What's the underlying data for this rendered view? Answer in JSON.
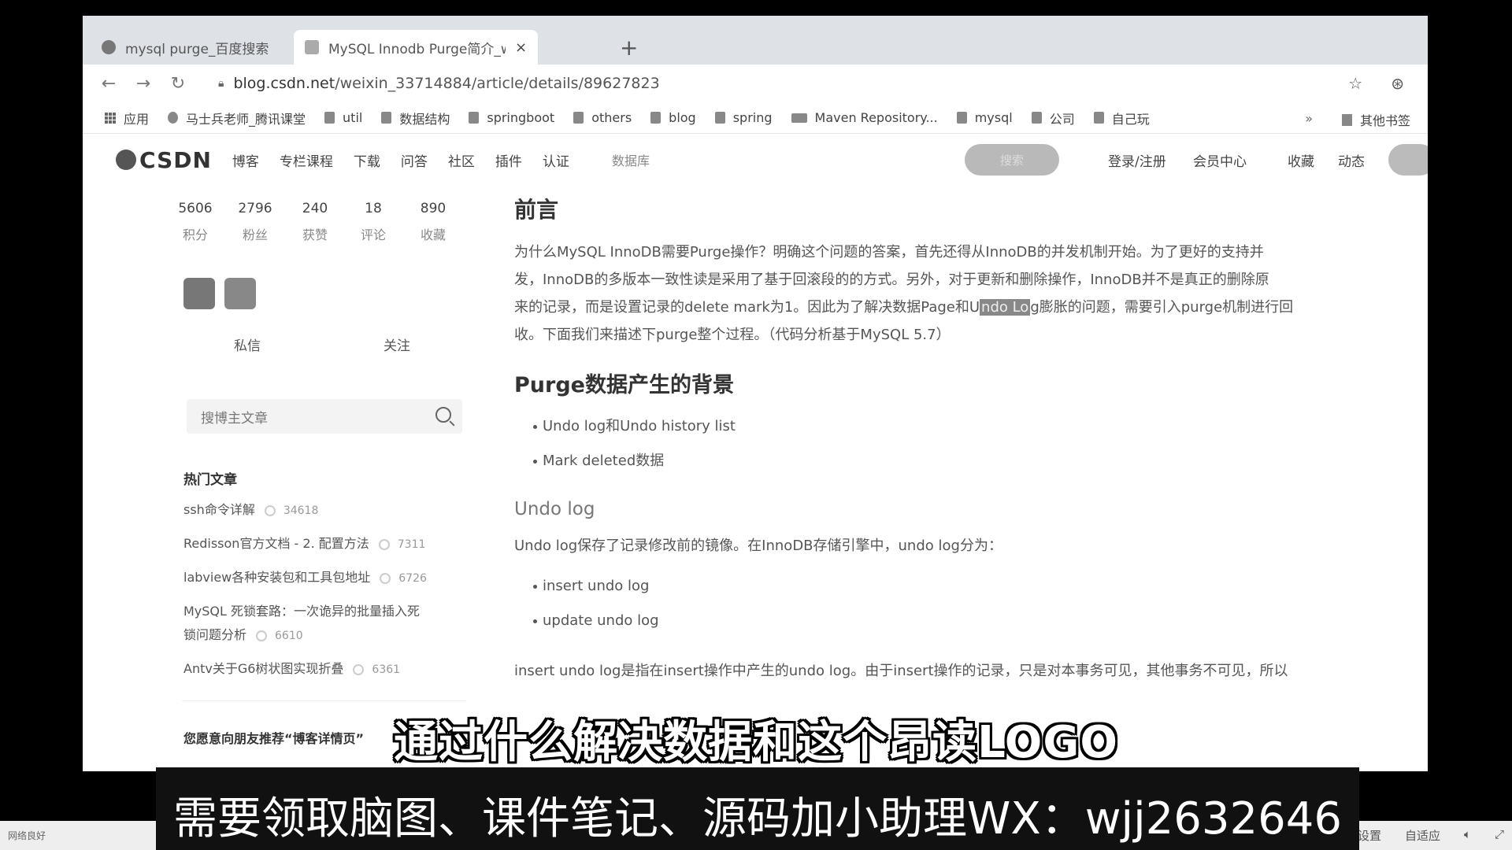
{
  "tabs": [
    {
      "title": "mysql purge_百度搜索",
      "close": "×"
    },
    {
      "title": "MySQL Innodb Purge简介_we",
      "close": "×"
    }
  ],
  "new_tab": "+",
  "url": {
    "host": "blog.csdn.net",
    "path": "/weixin_33714884/article/details/89627823"
  },
  "bookmarks": [
    "应用",
    "马士兵老师_腾讯课堂",
    "util",
    "数据结构",
    "springboot",
    "others",
    "blog",
    "spring",
    "Maven Repository...",
    "mysql",
    "公司",
    "自己玩"
  ],
  "bookmarks_more": "»",
  "bookmarks_other": "其他书签",
  "csdn": {
    "logo": "CSDN",
    "nav": [
      "博客",
      "专栏课程",
      "下载",
      "问答",
      "社区",
      "插件",
      "认证"
    ],
    "search_placeholder": "数据库",
    "search_button": "搜索",
    "right": [
      "登录/注册",
      "会员中心",
      "收藏",
      "动态"
    ]
  },
  "profile": {
    "stats": [
      {
        "value": "5606",
        "label": "积分"
      },
      {
        "value": "2796",
        "label": "粉丝"
      },
      {
        "value": "240",
        "label": "获赞"
      },
      {
        "value": "18",
        "label": "评论"
      },
      {
        "value": "890",
        "label": "收藏"
      }
    ],
    "message": "私信",
    "follow": "关注",
    "search_placeholder": "搜博主文章"
  },
  "hot": {
    "title": "热门文章",
    "items": [
      {
        "title": "ssh命令详解",
        "count": "34618"
      },
      {
        "title": "Redisson官方文档 - 2. 配置方法",
        "count": "7311"
      },
      {
        "title": "labview各种安装包和工具包地址",
        "count": "6726"
      },
      {
        "title": "MySQL 死锁套路：一次诡异的批量插入死",
        "title2": "锁问题分析",
        "count": "6610"
      },
      {
        "title": "Antv关于G6树状图实现折叠",
        "count": "6361"
      }
    ],
    "recommend": "您愿意向朋友推荐“博客详情页”"
  },
  "article": {
    "h_preface": "前言",
    "p1_a": "为什么MySQL InnoDB需要Purge操作？明确这个问题的答案，首先还得从InnoDB的并发机制开始。为了更好的支持并",
    "p1_b": "发，InnoDB的多版本一致性读是采用了基于回滚段的的方式。另外，对于更新和删除操作，InnoDB并不是真正的删除原",
    "p1_c_pre": "来的记录，而是设置记录的delete mark为1。因此为了解决数据Page和U",
    "p1_c_hl": "ndo Lo",
    "p1_c_post": "g膨胀的问题，需要引入purge机制进行回",
    "p1_d": "收。下面我们来描述下purge整个过程。（代码分析基于MySQL 5.7）",
    "h_bg": "Purge数据产生的背景",
    "bg_items": [
      "Undo log和Undo history list",
      "Mark deleted数据"
    ],
    "h_undo": "Undo log",
    "p2": "Undo log保存了记录修改前的镜像。在InnoDB存储引擎中，undo log分为：",
    "undo_items": [
      "insert undo log",
      "update undo log"
    ],
    "p3": "insert undo log是指在insert操作中产生的undo log。由于insert操作的记录，只是对本事务可见，其他事务不可见，所以"
  },
  "subtitle_1": "通过什么解决数据和这个昂读LOGO",
  "subtitle_2": "需要领取脑图、课件笔记、源码加小助理WX：wjj2632646",
  "bottom": {
    "net": "网络良好",
    "items": [
      "视频设置",
      "自适应"
    ]
  }
}
